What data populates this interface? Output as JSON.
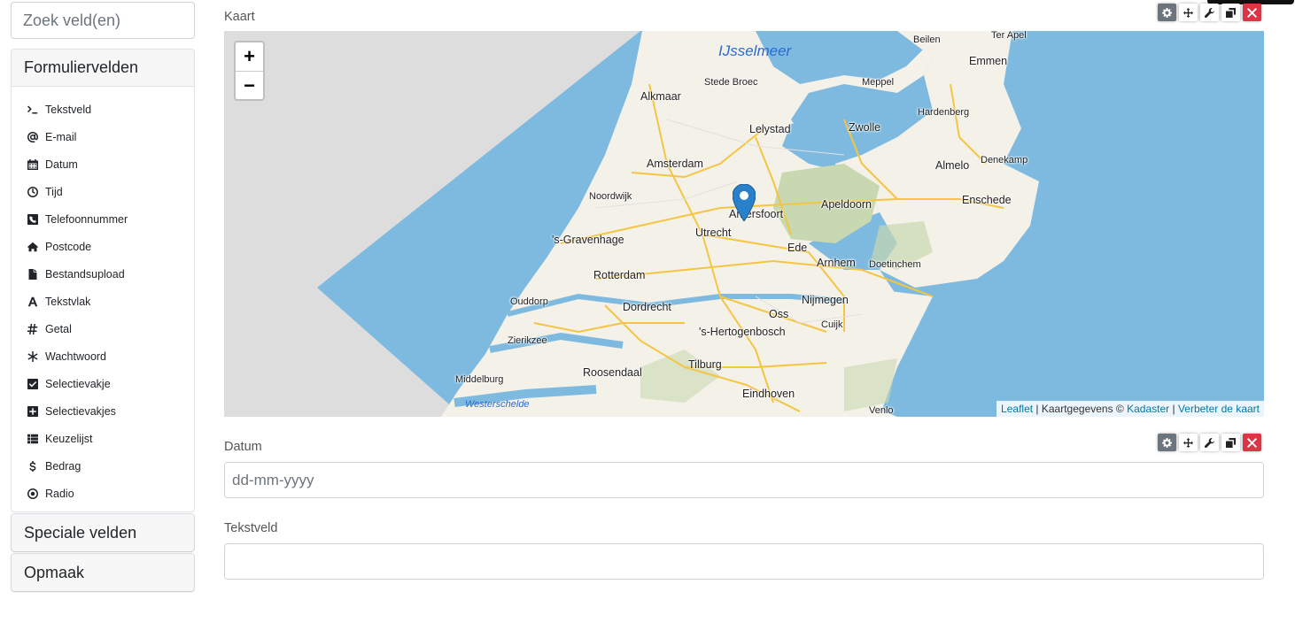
{
  "sidebar": {
    "search_placeholder": "Zoek veld(en)",
    "sections": {
      "form_fields": "Formuliervelden",
      "special_fields": "Speciale velden",
      "layout": "Opmaak"
    },
    "items": [
      {
        "label": "Tekstveld",
        "icon": "terminal-icon"
      },
      {
        "label": "E-mail",
        "icon": "at-icon"
      },
      {
        "label": "Datum",
        "icon": "calendar-icon"
      },
      {
        "label": "Tijd",
        "icon": "clock-icon"
      },
      {
        "label": "Telefoonnummer",
        "icon": "phone-square-icon"
      },
      {
        "label": "Postcode",
        "icon": "home-icon"
      },
      {
        "label": "Bestandsupload",
        "icon": "file-icon"
      },
      {
        "label": "Tekstvlak",
        "icon": "font-icon"
      },
      {
        "label": "Getal",
        "icon": "hashtag-icon"
      },
      {
        "label": "Wachtwoord",
        "icon": "asterisk-icon"
      },
      {
        "label": "Selectievakje",
        "icon": "check-square-icon"
      },
      {
        "label": "Selectievakjes",
        "icon": "plus-square-icon"
      },
      {
        "label": "Keuzelijst",
        "icon": "list-icon"
      },
      {
        "label": "Bedrag",
        "icon": "dollar-icon"
      },
      {
        "label": "Radio",
        "icon": "dot-circle-icon"
      }
    ]
  },
  "main": {
    "map_field": {
      "label": "Kaart",
      "zoom_in": "+",
      "zoom_out": "−",
      "attribution": {
        "leaflet": "Leaflet",
        "separator1": " | Kaartgegevens © ",
        "kadaster": "Kadaster",
        "separator2": " | ",
        "improve": "Verbeter de kaart"
      },
      "water_labels": {
        "lake": "IJsselmeer",
        "estuary": "Westerschelde"
      },
      "cities": {
        "beilen": "Beilen",
        "ter_apel": "Ter Apel",
        "emmen": "Emmen",
        "stede_broec": "Stede Broec",
        "meppel": "Meppel",
        "alkmaar": "Alkmaar",
        "lelystad": "Lelystad",
        "zwolle": "Zwolle",
        "hardenberg": "Hardenberg",
        "amsterdam": "Amsterdam",
        "almelo": "Almelo",
        "denekamp": "Denekamp",
        "noordwijk": "Noordwijk",
        "amersfoort": "Amersfoort",
        "apeldoorn": "Apeldoorn",
        "enschede": "Enschede",
        "den_haag": "'s-Gravenhage",
        "utrecht": "Utrecht",
        "ede": "Ede",
        "arnhem": "Arnhem",
        "doetinchem": "Doetinchem",
        "rotterdam": "Rotterdam",
        "ouddorp": "Ouddorp",
        "dordrecht": "Dordrecht",
        "nijmegen": "Nijmegen",
        "oss": "Oss",
        "zierikzee": "Zierikzee",
        "den_bosch": "'s-Hertogenbosch",
        "cuijk": "Cuijk",
        "tilburg": "Tilburg",
        "roosendaal": "Roosendaal",
        "middelburg": "Middelburg",
        "eindhoven": "Eindhoven",
        "venlo": "Venlo"
      }
    },
    "date_field": {
      "label": "Datum",
      "placeholder": "dd-mm-yyyy",
      "value": ""
    },
    "text_field": {
      "label": "Tekstveld",
      "placeholder": "",
      "value": ""
    }
  },
  "colors": {
    "accent_gear": "#6c757d",
    "accent_delete": "#dc3545",
    "link": "#0078a8",
    "water": "#7ebae0",
    "marker": "#2a81cb"
  }
}
